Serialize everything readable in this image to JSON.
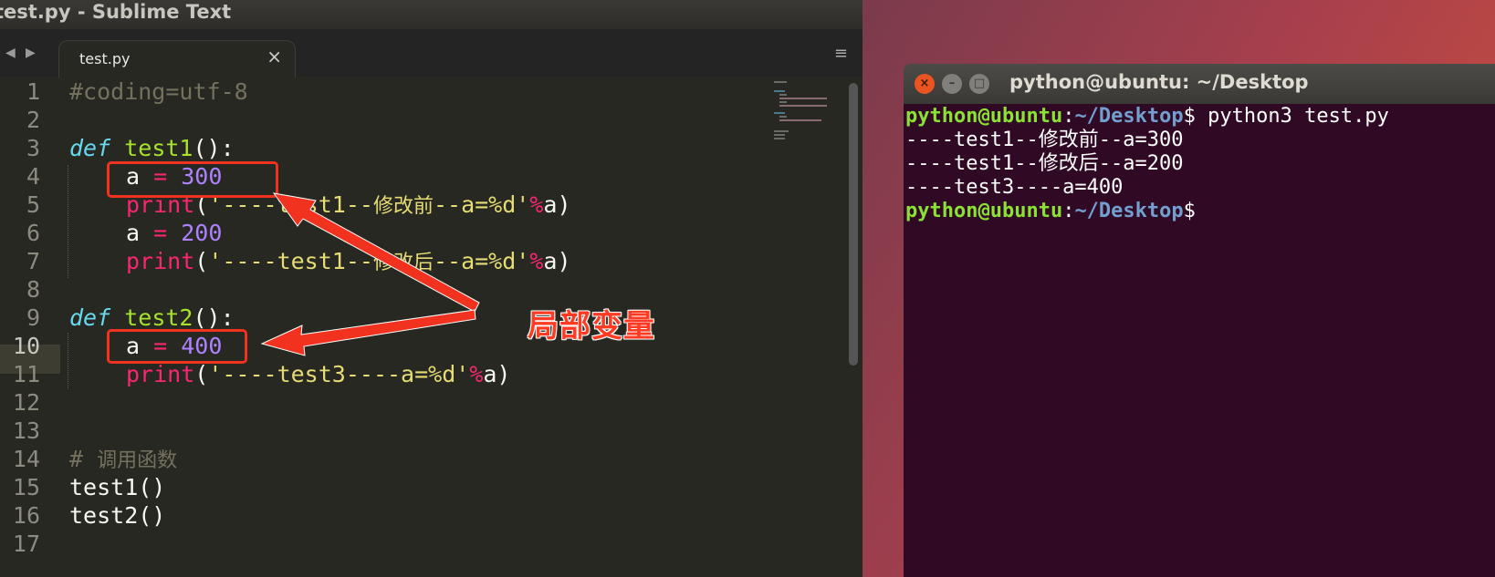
{
  "sublime": {
    "window_title": "test.py - Sublime Text",
    "tab_label": "test.py",
    "tab_close": "×",
    "nav_back": "◀",
    "nav_forward": "▶",
    "menu_glyph": "≡",
    "line_numbers": [
      "1",
      "2",
      "3",
      "4",
      "5",
      "6",
      "7",
      "8",
      "9",
      "10",
      "11",
      "12",
      "13",
      "14",
      "15",
      "16",
      "17"
    ],
    "code": {
      "l1": "#coding=utf-8",
      "l3_kw": "def",
      "l3_fn": "test1",
      "l3_rest": "():",
      "l4_var": "a",
      "l4_op": "=",
      "l4_num": "300",
      "l5_fn": "print",
      "l5_p1": "(",
      "l5_s1": "'----test1--",
      "l5_zh": "修改前",
      "l5_s2": "--a=%d'",
      "l5_op": "%",
      "l5_end": "a)",
      "l6_var": "a",
      "l6_op": "=",
      "l6_num": "200",
      "l7_fn": "print",
      "l7_p1": "(",
      "l7_s1": "'----test1--",
      "l7_zh": "修改后",
      "l7_s2": "--a=%d'",
      "l7_op": "%",
      "l7_end": "a)",
      "l9_kw": "def",
      "l9_fn": "test2",
      "l9_rest": "():",
      "l10_var": "a",
      "l10_op": "=",
      "l10_num": "400",
      "l11_fn": "print",
      "l11_p1": "(",
      "l11_s1": "'----test3----a=%d'",
      "l11_op": "%",
      "l11_end": "a)",
      "l14_hash": "#",
      "l14_zh": "调用函数",
      "l15": "test1()",
      "l16": "test2()"
    },
    "annotation_label": "局部变量",
    "annotation_color": "#f0321e"
  },
  "terminal": {
    "title": "python@ubuntu: ~/Desktop",
    "close_glyph": "×",
    "min_glyph": "–",
    "max_glyph": "□",
    "prompt_user": "python@ubuntu",
    "prompt_sep": ":",
    "prompt_path": "~/Desktop",
    "prompt_dollar": "$",
    "command": " python3 test.py",
    "out1_a": "----test1--",
    "out1_zh": "修改前",
    "out1_b": "--a=300",
    "out2_a": "----test1--",
    "out2_zh": "修改后",
    "out2_b": "--a=200",
    "out3": "----test3----a=400"
  },
  "colors": {
    "editor_bg": "#272822",
    "terminal_bg": "#300a24",
    "prompt_user": "#8ae234",
    "prompt_path": "#729fcf",
    "annotation": "#f0321e"
  }
}
